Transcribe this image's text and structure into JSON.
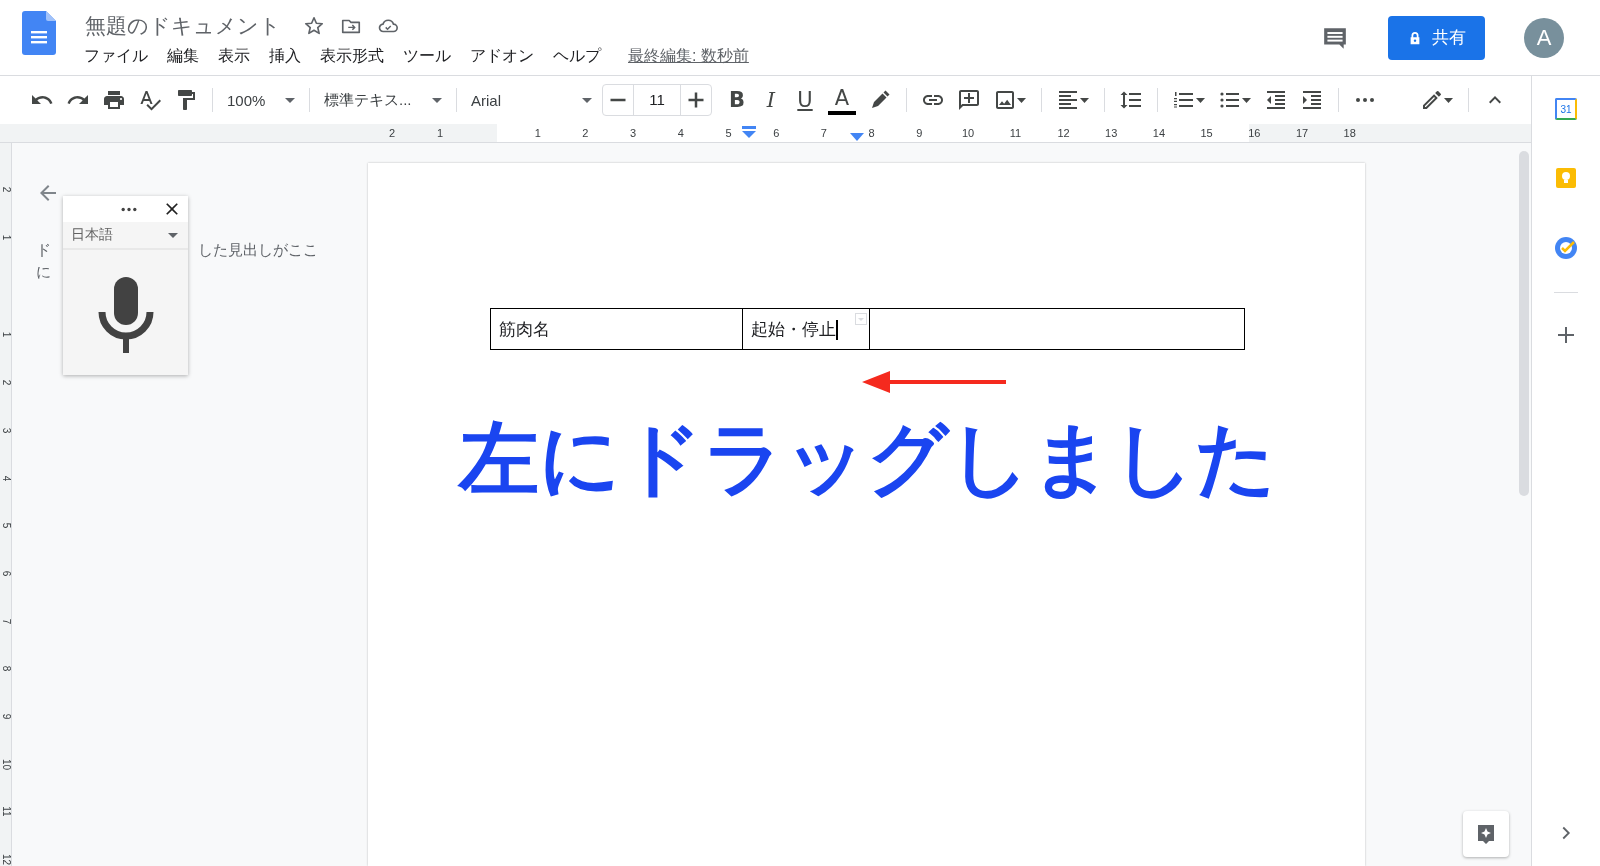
{
  "header": {
    "title": "無題のドキュメント",
    "menu": [
      "ファイル",
      "編集",
      "表示",
      "挿入",
      "表示形式",
      "ツール",
      "アドオン",
      "ヘルプ"
    ],
    "last_edit": "最終編集: 数秒前",
    "share_button": "共有",
    "avatar": "A"
  },
  "toolbar": {
    "zoom": "100%",
    "style": "標準テキス...",
    "font": "Arial",
    "font_size": "11",
    "format_buttons": [
      {
        "label": "B",
        "kind": "bold"
      },
      {
        "label": "I",
        "kind": "italic"
      },
      {
        "label": "U",
        "kind": "underline"
      }
    ],
    "text_color": "A"
  },
  "ruler": {
    "labels": [
      "2",
      "1",
      "1",
      "2",
      "3",
      "4",
      "5",
      "6",
      "7",
      "8",
      "9",
      "10",
      "11",
      "12",
      "13",
      "14",
      "15",
      "16",
      "17",
      "18"
    ]
  },
  "vertical_ruler": {
    "labels": [
      "2",
      "1",
      "1",
      "2",
      "3",
      "4",
      "5",
      "6",
      "7",
      "8",
      "9",
      "10",
      "11",
      "12"
    ]
  },
  "outline": {
    "line_1_start": "ド",
    "line_1_end": "した見出しがここ",
    "line_2_start": "に"
  },
  "voice_typing": {
    "language": "日本語"
  },
  "table": {
    "rows": [
      [
        "筋肉名",
        "起始・停止",
        ""
      ]
    ]
  },
  "annotation": "左にドラッグしました",
  "side_panel": {
    "calendar_day": "31"
  }
}
